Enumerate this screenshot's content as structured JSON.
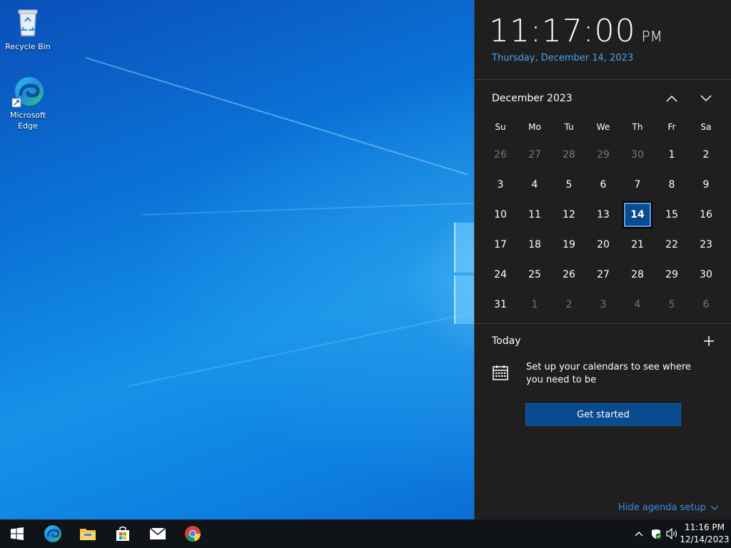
{
  "desktop": {
    "icons": [
      {
        "label": "Recycle Bin",
        "icon": "recycle-bin-icon"
      },
      {
        "label": "Microsoft Edge",
        "icon": "edge-icon"
      }
    ]
  },
  "flyout": {
    "time": "11:17:00",
    "ampm": "PM",
    "date": "Thursday, December 14, 2023",
    "month_label": "December 2023",
    "prev_icon": "chevron-up-icon",
    "next_icon": "chevron-down-icon",
    "weekdays": [
      "Su",
      "Mo",
      "Tu",
      "We",
      "Th",
      "Fr",
      "Sa"
    ],
    "weeks": [
      [
        "26",
        "27",
        "28",
        "29",
        "30",
        "1",
        "2"
      ],
      [
        "3",
        "4",
        "5",
        "6",
        "7",
        "8",
        "9"
      ],
      [
        "10",
        "11",
        "12",
        "13",
        "14",
        "15",
        "16"
      ],
      [
        "17",
        "18",
        "19",
        "20",
        "21",
        "22",
        "23"
      ],
      [
        "24",
        "25",
        "26",
        "27",
        "28",
        "29",
        "30"
      ],
      [
        "31",
        "1",
        "2",
        "3",
        "4",
        "5",
        "6"
      ]
    ],
    "selected_day": "14",
    "today_label": "Today",
    "agenda_message": "Set up your calendars to see where you need to be",
    "get_started_label": "Get started",
    "hide_agenda_label": "Hide agenda setup"
  },
  "taskbar": {
    "pinned": [
      "start-icon",
      "edge-icon",
      "file-explorer-icon",
      "store-icon",
      "mail-icon",
      "chrome-icon"
    ],
    "tray": [
      "chevron-up-icon",
      "security-icon",
      "volume-icon"
    ],
    "time": "11:16 PM",
    "date": "12/14/2023"
  },
  "colors": {
    "accent": "#0a4a8f",
    "link": "#4aa3f0",
    "flyout_bg": "#1f1f1f",
    "taskbar_bg": "#101418"
  }
}
